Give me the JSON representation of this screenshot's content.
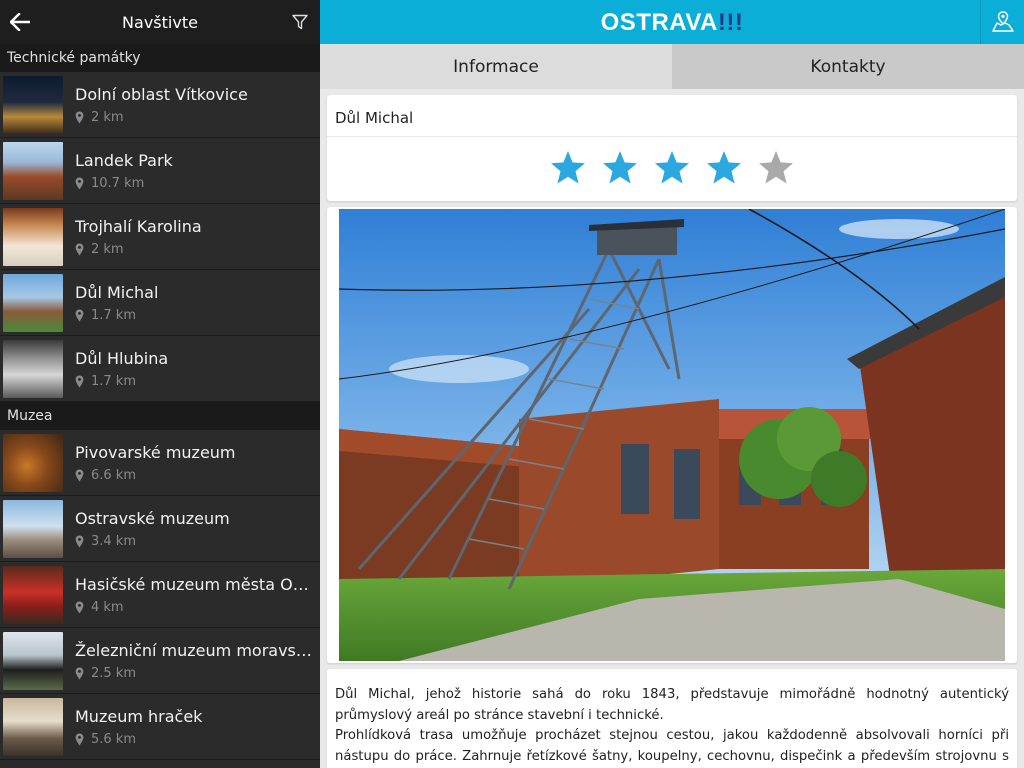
{
  "sidebar": {
    "title": "Navštivte",
    "back_icon": "arrow-left-icon",
    "filter_icon": "filter-icon",
    "sections": [
      {
        "header": "Technické památky",
        "items": [
          {
            "name": "Dolní oblast Vítkovice",
            "distance": "2 km"
          },
          {
            "name": "Landek Park",
            "distance": "10.7 km"
          },
          {
            "name": "Trojhalí Karolina",
            "distance": "2 km"
          },
          {
            "name": "Důl Michal",
            "distance": "1.7 km"
          },
          {
            "name": "Důl Hlubina",
            "distance": "1.7 km"
          }
        ]
      },
      {
        "header": "Muzea",
        "items": [
          {
            "name": "Pivovarské muzeum",
            "distance": "6.6 km"
          },
          {
            "name": "Ostravské muzeum",
            "distance": "3.4 km"
          },
          {
            "name": "Hasičské muzeum města Os...",
            "distance": "4 km"
          },
          {
            "name": "Železniční muzeum moravsk...",
            "distance": "2.5 km"
          },
          {
            "name": "Muzeum hraček",
            "distance": "5.6 km"
          }
        ]
      }
    ]
  },
  "header": {
    "logo_text": "OSTRAVA",
    "logo_suffix": "!!!",
    "map_icon": "map-icon"
  },
  "tabs": [
    {
      "label": "Informace",
      "active": true
    },
    {
      "label": "Kontakty",
      "active": false
    }
  ],
  "detail": {
    "title": "Důl Michal",
    "rating": 4,
    "rating_max": 5,
    "paragraph_1": "Důl Michal, jehož historie sahá do roku 1843, představuje mimořádně hodnotný autentický průmyslový areál po stránce stavební i technické.",
    "paragraph_2": "Prohlídková trasa umožňuje procházet stejnou cestou, jakou každodenně absolvovali horníci při nástupu do práce. Zahrnuje řetízkové šatny, koupelny, cechovnu, dispečink a především strojovnu s původním"
  },
  "colors": {
    "accent": "#0aaed6",
    "star_filled": "#2ba8e0",
    "star_empty": "#a9a9a9",
    "sidebar_bg": "#2a2a2a"
  }
}
